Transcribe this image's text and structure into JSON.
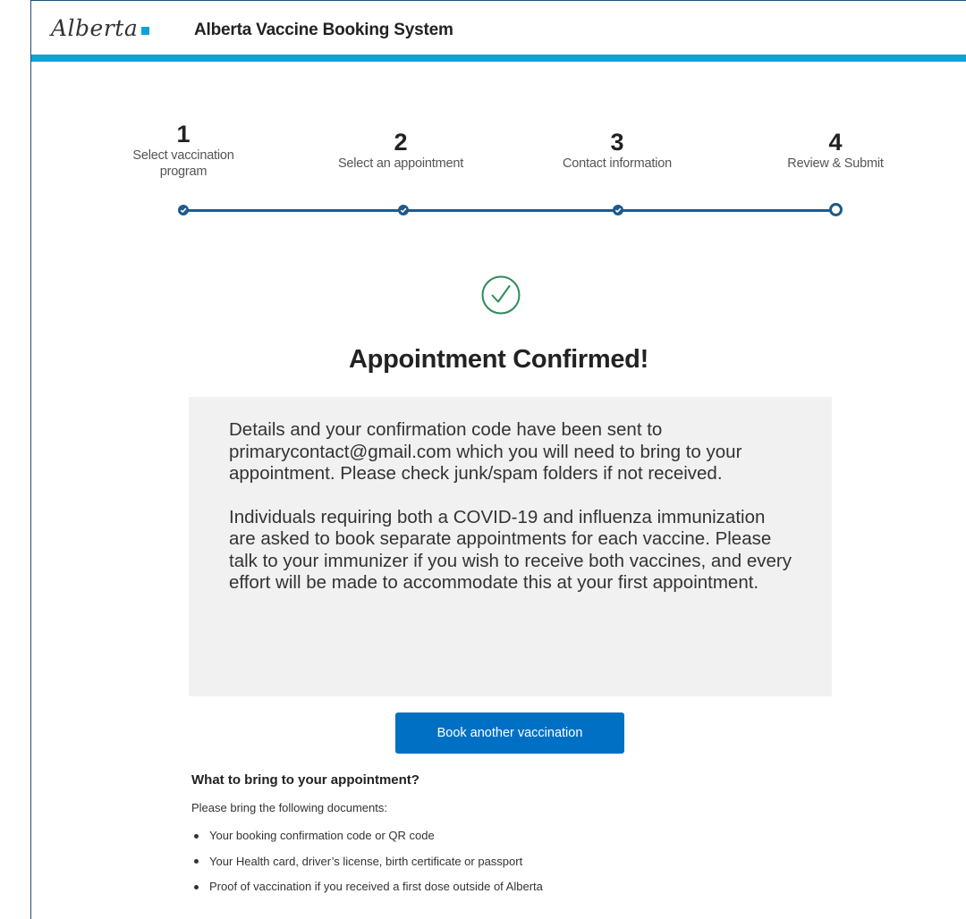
{
  "header": {
    "logo_text": "Alberta",
    "app_title": "Alberta Vaccine Booking System",
    "accent_color": "#0fa2d6"
  },
  "stepper": {
    "steps": [
      {
        "number": "1",
        "label_line1": "Select vaccination",
        "label_line2": "program",
        "state": "complete"
      },
      {
        "number": "2",
        "label_line1": "Select an appointment",
        "label_line2": "",
        "state": "complete"
      },
      {
        "number": "3",
        "label_line1": "Contact information",
        "label_line2": "",
        "state": "complete"
      },
      {
        "number": "4",
        "label_line1": "Review & Submit",
        "label_line2": "",
        "state": "current"
      }
    ],
    "track_color": "#1f5a8a"
  },
  "confirmation": {
    "icon": "check-circle-icon",
    "icon_color": "#2e8b57",
    "title": "Appointment Confirmed!",
    "paragraph_1": "Details and your confirmation code have been sent to primarycontact@gmail.com which you will need to bring to your appointment. Please check junk/spam folders if not received.",
    "paragraph_2": "Individuals requiring both a COVID-19 and influenza immunization are asked to book separate appointments for each vaccine. Please talk to your immunizer if you wish to receive both vaccines, and every effort will be made to accommodate this at your first appointment."
  },
  "actions": {
    "book_another_label": "Book another vaccination",
    "button_color": "#0070c4"
  },
  "bring": {
    "title": "What to bring to your appointment?",
    "intro": "Please bring the following documents:",
    "items": [
      "Your booking confirmation code or QR code",
      "Your Health card, driver’s license, birth certificate or passport",
      "Proof of vaccination if you received a first dose outside of Alberta"
    ]
  }
}
